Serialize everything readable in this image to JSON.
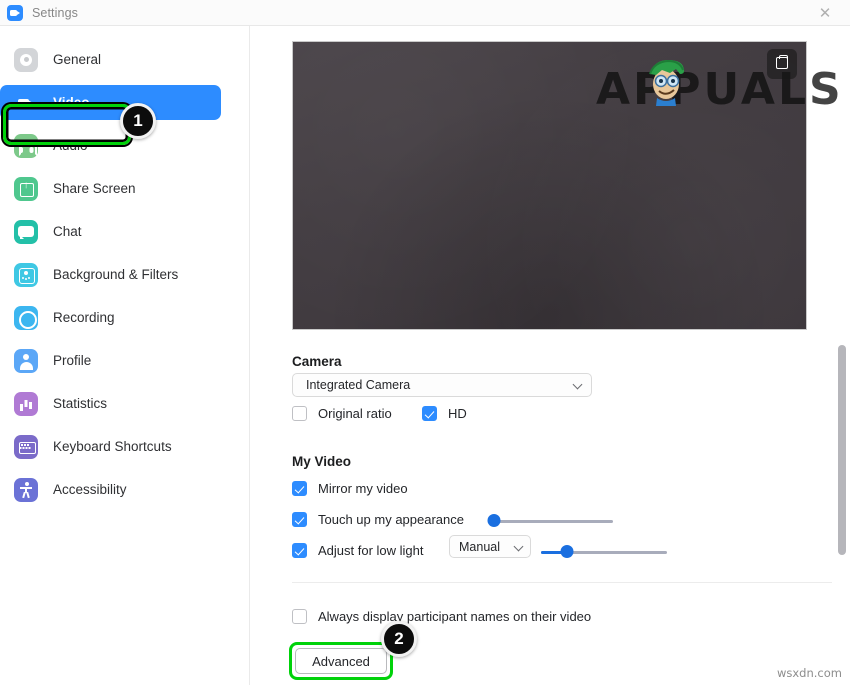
{
  "window": {
    "title": "Settings",
    "logo_icon": "zoom-logo-icon",
    "close_icon": "✕"
  },
  "sidebar": {
    "items": [
      {
        "label": "General",
        "icon": "gear-icon",
        "active": false
      },
      {
        "label": "Video",
        "icon": "video-camera-icon",
        "active": true
      },
      {
        "label": "Audio",
        "icon": "headphones-icon",
        "active": false
      },
      {
        "label": "Share Screen",
        "icon": "share-screen-icon",
        "active": false
      },
      {
        "label": "Chat",
        "icon": "chat-bubble-icon",
        "active": false
      },
      {
        "label": "Background & Filters",
        "icon": "background-icon",
        "active": false
      },
      {
        "label": "Recording",
        "icon": "record-circle-icon",
        "active": false
      },
      {
        "label": "Profile",
        "icon": "person-icon",
        "active": false
      },
      {
        "label": "Statistics",
        "icon": "bar-chart-icon",
        "active": false
      },
      {
        "label": "Keyboard Shortcuts",
        "icon": "keyboard-icon",
        "active": false
      },
      {
        "label": "Accessibility",
        "icon": "accessibility-icon",
        "active": false
      }
    ]
  },
  "annotations": {
    "step1": "1",
    "step2": "2",
    "highlight_color": "#00d20a"
  },
  "preview": {
    "watermark_text": "APPUALS",
    "pip_button_icon": "picture-in-picture-icon"
  },
  "main": {
    "camera": {
      "title": "Camera",
      "selected_device": "Integrated Camera",
      "options": {
        "original_ratio": {
          "label": "Original ratio",
          "checked": false
        },
        "hd": {
          "label": "HD",
          "checked": true
        }
      }
    },
    "my_video": {
      "title": "My Video",
      "mirror": {
        "label": "Mirror my video",
        "checked": true
      },
      "touch_up": {
        "label": "Touch up my appearance",
        "checked": true,
        "slider_value": 0
      },
      "low_light": {
        "label": "Adjust for low light",
        "checked": true,
        "mode": "Manual",
        "slider_value": 18
      }
    },
    "always_display_names": {
      "label": "Always display participant names on their video",
      "checked": false
    },
    "advanced_button": "Advanced"
  },
  "footer": {
    "site_watermark": "wsxdn.com"
  }
}
